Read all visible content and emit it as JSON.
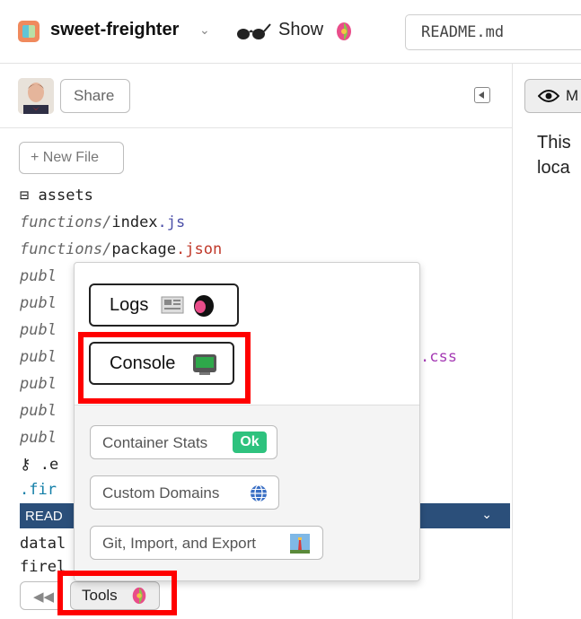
{
  "header": {
    "project_name": "sweet-freighter",
    "project_icon": "project-avatar-icon",
    "show_label": "Show",
    "search_value": "README.md"
  },
  "sidebar": {
    "share_label": "Share",
    "new_file_label": "+ New File",
    "files": [
      {
        "prefix": "",
        "name": "assets",
        "ext": "",
        "icon": "archive-icon"
      },
      {
        "prefix": "functions/",
        "name": "index",
        "ext": ".js"
      },
      {
        "prefix": "functions/",
        "name": "package",
        "ext": ".json"
      },
      {
        "prefix": "publ",
        "name": "",
        "ext": ""
      },
      {
        "prefix": "publ",
        "name": "",
        "ext": ""
      },
      {
        "prefix": "publ",
        "name": "",
        "ext": ""
      },
      {
        "prefix": "publ",
        "name": "",
        "ext": ".css"
      },
      {
        "prefix": "publ",
        "name": "",
        "ext": ""
      },
      {
        "prefix": "publ",
        "name": "",
        "ext": ""
      },
      {
        "prefix": "publ",
        "name": "",
        "ext": ""
      },
      {
        "prefix": "",
        "name": ".e",
        "ext": "",
        "icon": "key-icon"
      },
      {
        "prefix": "",
        "name": ".fir",
        "ext": ""
      },
      {
        "prefix": "",
        "name": "datal",
        "ext": ""
      },
      {
        "prefix": "",
        "name": "firel",
        "ext": ""
      }
    ],
    "selected_file": "READ",
    "footer": {
      "rewind_label": "◀◀",
      "tools_label": "Tools"
    }
  },
  "tools_popup": {
    "logs_label": "Logs",
    "console_label": "Console",
    "container_stats_label": "Container Stats",
    "ok_label": "Ok",
    "custom_domains_label": "Custom Domains",
    "git_label": "Git, Import, and Export"
  },
  "preview": {
    "markdown_label": "M",
    "text_line1": "This",
    "text_line2": "loca"
  },
  "colors": {
    "highlight": "#ff0000",
    "selected_row": "#2b4f7a",
    "ok_badge": "#2ec27e"
  }
}
